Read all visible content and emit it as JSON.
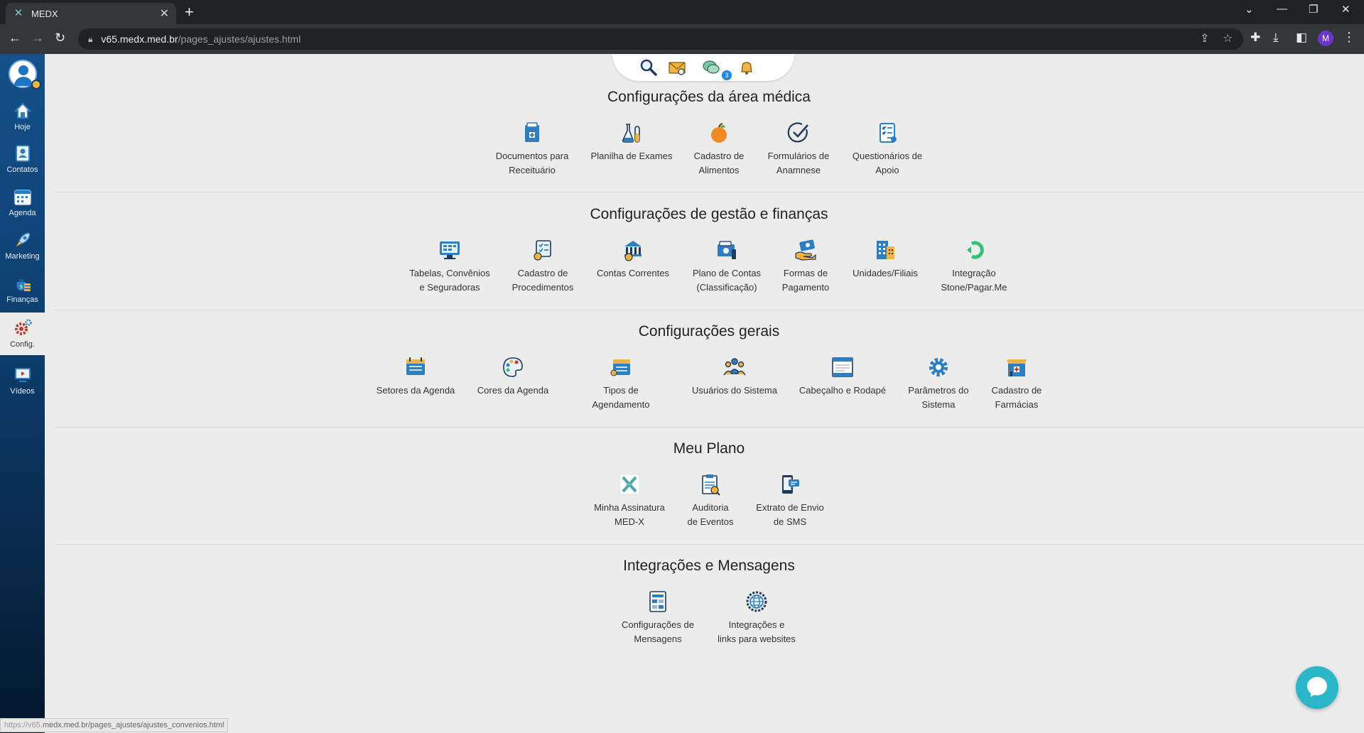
{
  "browser": {
    "tab_title": "MEDX",
    "tab_close": "✕",
    "new_tab": "+",
    "url_host": "v65.medx.med.br",
    "url_path": "/pages_ajustes/ajustes.html",
    "profile_initial": "M"
  },
  "sidebar": {
    "items": [
      {
        "label": "Hoje",
        "icon": "home-icon"
      },
      {
        "label": "Contatos",
        "icon": "contacts-icon"
      },
      {
        "label": "Agenda",
        "icon": "calendar-icon"
      },
      {
        "label": "Marketing",
        "icon": "rocket-icon"
      },
      {
        "label": "Finanças",
        "icon": "money-bag-icon"
      },
      {
        "label": "Config.",
        "icon": "gears-icon"
      },
      {
        "label": "Vídeos",
        "icon": "video-icon"
      }
    ]
  },
  "topwidget": {
    "message_badge": "3"
  },
  "sections": [
    {
      "title": "Configurações da área médica",
      "items": [
        {
          "label": "Documentos para\nReceituário",
          "icon": "prescription-document-icon"
        },
        {
          "label": "Planilha de Exames",
          "icon": "lab-flasks-icon"
        },
        {
          "label": "Cadastro de\nAlimentos",
          "icon": "apple-icon"
        },
        {
          "label": "Formulários de\nAnamnese",
          "icon": "checkmark-icon"
        },
        {
          "label": "Questionários de\nApoio",
          "icon": "checklist-icon"
        }
      ]
    },
    {
      "title": "Configurações de gestão e finanças",
      "items": [
        {
          "label": "Tabelas, Convênios\ne Seguradoras",
          "icon": "monitor-table-icon"
        },
        {
          "label": "Cadastro de\nProcedimentos",
          "icon": "procedures-icon"
        },
        {
          "label": "Contas Correntes",
          "icon": "bank-account-icon"
        },
        {
          "label": "Plano de Contas\n(Classificação)",
          "icon": "wallet-icon"
        },
        {
          "label": "Formas de\nPagamento",
          "icon": "payment-hand-icon"
        },
        {
          "label": "Unidades/Filiais",
          "icon": "building-icon"
        },
        {
          "label": "Integração\nStone/Pagar.Me",
          "icon": "stone-logo-icon"
        }
      ]
    },
    {
      "title": "Configurações gerais",
      "items": [
        {
          "label": "Setores da Agenda",
          "icon": "agenda-icon"
        },
        {
          "label": "Cores da Agenda",
          "icon": "palette-icon"
        },
        {
          "label": "Tipos de Agendamento",
          "icon": "appointment-types-icon"
        },
        {
          "label": "Usuários do Sistema",
          "icon": "users-icon"
        },
        {
          "label": "Cabeçalho e Rodapé",
          "icon": "header-footer-icon"
        },
        {
          "label": "Parâmetros do\nSistema",
          "icon": "gear-icon"
        },
        {
          "label": "Cadastro de\nFarmácias",
          "icon": "pharmacy-icon"
        }
      ]
    },
    {
      "title": "Meu Plano",
      "items": [
        {
          "label": "Minha Assinatura\nMED-X",
          "icon": "medx-logo-icon"
        },
        {
          "label": "Auditoria\nde Eventos",
          "icon": "audit-icon"
        },
        {
          "label": "Extrato de Envio\nde SMS",
          "icon": "sms-icon"
        }
      ]
    },
    {
      "title": "Integrações e Mensagens",
      "items": [
        {
          "label": "Configurações de\nMensagens",
          "icon": "message-settings-icon"
        },
        {
          "label": "Integrações e\nlinks para websites",
          "icon": "globe-gear-icon"
        }
      ]
    }
  ],
  "status_bar": {
    "prefix": "https://v65.",
    "rest": "medx.med.br/pages_ajustes/ajustes_convenios.html"
  },
  "colors": {
    "sidebar": "#0d3f70",
    "accent": "#1e88e5",
    "icon_blue": "#2d7fc1",
    "icon_yellow": "#f3b33d",
    "chat": "#2bb7c9"
  }
}
